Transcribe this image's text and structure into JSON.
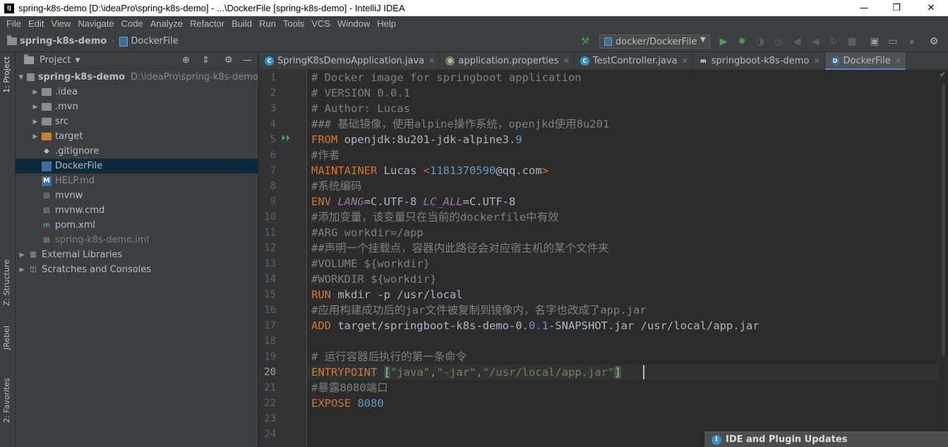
{
  "window": {
    "title": "spring-k8s-demo [D:\\ideaPro\\spring-k8s-demo] - ...\\DockerFile [spring-k8s-demo] - IntelliJ IDEA",
    "app_icon": "IJ",
    "minimize": "—",
    "maximize": "❐",
    "close": "✕"
  },
  "menu": [
    "File",
    "Edit",
    "View",
    "Navigate",
    "Code",
    "Analyze",
    "Refactor",
    "Build",
    "Run",
    "Tools",
    "VCS",
    "Window",
    "Help"
  ],
  "breadcrumb": {
    "project": "spring-k8s-demo",
    "file": "DockerFile"
  },
  "toolbar": {
    "run_config": "docker/DockerFile"
  },
  "left_strip": {
    "project_tab": "1: Project",
    "structure_tab": "Z: Structure",
    "jrebel_tab": "JRebel",
    "favorites_tab": "2: Favorites"
  },
  "project_panel": {
    "header": "Project",
    "tree": [
      {
        "label": "spring-k8s-demo",
        "path": "D:\\ideaPro\\spring-k8s-demo",
        "level": 0,
        "type": "root",
        "expanded": true
      },
      {
        "label": ".idea",
        "level": 1,
        "type": "folder"
      },
      {
        "label": ".mvn",
        "level": 1,
        "type": "folder"
      },
      {
        "label": "src",
        "level": 1,
        "type": "folder"
      },
      {
        "label": "target",
        "level": 1,
        "type": "folder-orange"
      },
      {
        "label": ".gitignore",
        "level": 1,
        "type": "git"
      },
      {
        "label": "DockerFile",
        "level": 1,
        "type": "docker",
        "selected": true
      },
      {
        "label": "HELP.md",
        "level": 1,
        "type": "md"
      },
      {
        "label": "mvnw",
        "level": 1,
        "type": "file"
      },
      {
        "label": "mvnw.cmd",
        "level": 1,
        "type": "file"
      },
      {
        "label": "pom.xml",
        "level": 1,
        "type": "maven"
      },
      {
        "label": "spring-k8s-demo.iml",
        "level": 1,
        "type": "iml"
      },
      {
        "label": "External Libraries",
        "level": 0,
        "type": "lib"
      },
      {
        "label": "Scratches and Consoles",
        "level": 0,
        "type": "scratch"
      }
    ]
  },
  "tabs": [
    {
      "label": "SpringK8sDemoApplication.java",
      "icon": "C",
      "color": "#3592c4"
    },
    {
      "label": "application.properties",
      "icon": "⚙",
      "color": "#6a8759"
    },
    {
      "label": "TestController.java",
      "icon": "C",
      "color": "#3592c4"
    },
    {
      "label": "springboot-k8s-demo",
      "icon": "m",
      "color": "#3c3f41"
    },
    {
      "label": "DockerFile",
      "icon": "D",
      "color": "#3c6e9c",
      "active": true
    }
  ],
  "editor": {
    "current_line": 20,
    "line_numbers": [
      "1",
      "2",
      "3",
      "4",
      "5",
      "6",
      "7",
      "8",
      "9",
      "10",
      "11",
      "12",
      "13",
      "14",
      "15",
      "16",
      "17",
      "18",
      "19",
      "20",
      "21",
      "22",
      "23",
      "24"
    ],
    "lines": [
      [
        {
          "t": "# Docker image for springboot application",
          "c": "com"
        }
      ],
      [
        {
          "t": "# VERSION 0.0.1",
          "c": "com"
        }
      ],
      [
        {
          "t": "# Author: Lucas",
          "c": "com"
        }
      ],
      [
        {
          "t": "### 基础镜像，使用alpine操作系统，openjkd使用8u201",
          "c": "com"
        }
      ],
      [
        {
          "t": "FROM ",
          "c": "kw"
        },
        {
          "t": "openjdk:8u201-jdk-alpine3.",
          "c": "plain"
        },
        {
          "t": "9",
          "c": "num"
        }
      ],
      [
        {
          "t": "#作者",
          "c": "com"
        }
      ],
      [
        {
          "t": "MAINTAINER ",
          "c": "kw"
        },
        {
          "t": "Lucas ",
          "c": "plain"
        },
        {
          "t": "<",
          "c": "kw"
        },
        {
          "t": "1181370590",
          "c": "num"
        },
        {
          "t": "@qq.com",
          "c": "plain"
        },
        {
          "t": ">",
          "c": "kw"
        }
      ],
      [
        {
          "t": "#系统编码",
          "c": "com"
        }
      ],
      [
        {
          "t": "ENV ",
          "c": "kw"
        },
        {
          "t": "LANG",
          "c": "var"
        },
        {
          "t": "=C.UTF-8 ",
          "c": "plain"
        },
        {
          "t": "LC_ALL",
          "c": "var"
        },
        {
          "t": "=C.UTF-8",
          "c": "plain"
        }
      ],
      [
        {
          "t": "#添加变量，该变量只在当前的dockerfile中有效",
          "c": "com"
        }
      ],
      [
        {
          "t": "#ARG workdir=/app",
          "c": "com"
        }
      ],
      [
        {
          "t": "##声明一个挂载点，容器内此路径会对应宿主机的某个文件夹",
          "c": "com"
        }
      ],
      [
        {
          "t": "#VOLUME ${workdir}",
          "c": "com"
        }
      ],
      [
        {
          "t": "#WORKDIR ${workdir}",
          "c": "com"
        }
      ],
      [
        {
          "t": "RUN ",
          "c": "kw"
        },
        {
          "t": "mkdir -p /usr/local",
          "c": "plain"
        }
      ],
      [
        {
          "t": "#应用构建成功后的jar文件被复制到镜像内，名字也改成了app.jar",
          "c": "com"
        }
      ],
      [
        {
          "t": "ADD ",
          "c": "kw"
        },
        {
          "t": "target/springboot-k8s-demo-0.",
          "c": "plain"
        },
        {
          "t": "0.1",
          "c": "num"
        },
        {
          "t": "-SNAPSHOT.jar /usr/local/app.jar",
          "c": "plain"
        }
      ],
      [
        {
          "t": "",
          "c": "plain"
        }
      ],
      [
        {
          "t": "# 运行容器后执行的第一条命令",
          "c": "com"
        }
      ],
      [
        {
          "t": "ENTRYPOINT ",
          "c": "kw"
        },
        {
          "t": "[",
          "c": "brk"
        },
        {
          "t": "\"java\"",
          "c": "str"
        },
        {
          "t": ",",
          "c": "kw"
        },
        {
          "t": "\"-jar\"",
          "c": "str"
        },
        {
          "t": ",",
          "c": "kw"
        },
        {
          "t": "\"/usr/local/app.jar\"",
          "c": "str"
        },
        {
          "t": "]",
          "c": "brk"
        }
      ],
      [
        {
          "t": "#暴露8080端口",
          "c": "com"
        }
      ],
      [
        {
          "t": "EXPOSE ",
          "c": "kw"
        },
        {
          "t": "8080",
          "c": "num"
        }
      ],
      [
        {
          "t": "",
          "c": "plain"
        }
      ],
      [
        {
          "t": "",
          "c": "plain"
        }
      ]
    ]
  },
  "notification": {
    "title": "IDE and Plugin Updates",
    "icon": "i"
  },
  "colors": {
    "accent": "#4a88c7",
    "keyword": "#cc7832",
    "comment": "#808080",
    "string": "#6a8759",
    "number": "#6897bb",
    "run_green": "#499c54"
  }
}
